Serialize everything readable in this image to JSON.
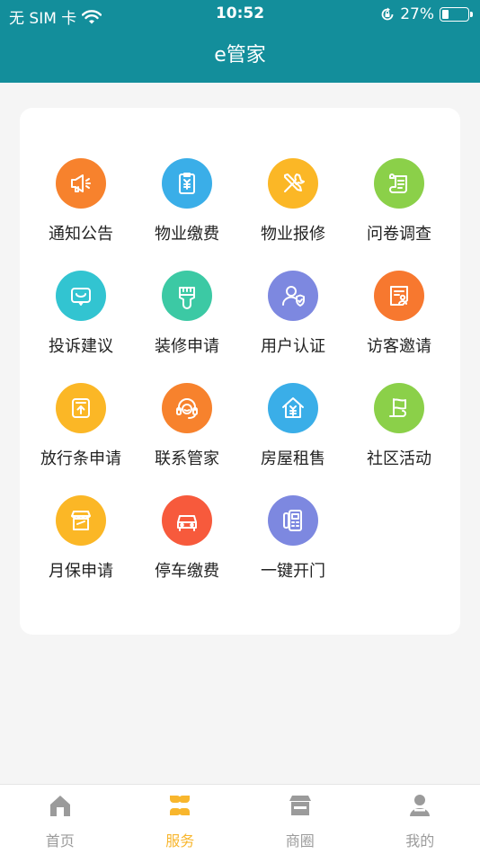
{
  "status_bar": {
    "carrier": "无 SIM 卡",
    "time": "10:52",
    "battery_text": "27%",
    "battery_level": 0.27
  },
  "header": {
    "title": "e管家"
  },
  "services": [
    {
      "label": "通知公告",
      "icon": "megaphone-icon",
      "color": "#f7822d"
    },
    {
      "label": "物业缴费",
      "icon": "bill-icon",
      "color": "#3aaee8"
    },
    {
      "label": "物业报修",
      "icon": "tools-icon",
      "color": "#fbb726"
    },
    {
      "label": "问卷调查",
      "icon": "scroll-icon",
      "color": "#8bd049"
    },
    {
      "label": "投诉建议",
      "icon": "message-box-icon",
      "color": "#32c4d1"
    },
    {
      "label": "装修申请",
      "icon": "paint-brush-icon",
      "color": "#3cc9a4"
    },
    {
      "label": "用户认证",
      "icon": "user-verified-icon",
      "color": "#7d88e0"
    },
    {
      "label": "访客邀请",
      "icon": "visitor-card-icon",
      "color": "#f7782f"
    },
    {
      "label": "放行条申请",
      "icon": "upload-pass-icon",
      "color": "#fbb726"
    },
    {
      "label": "联系管家",
      "icon": "headset-icon",
      "color": "#f7822d"
    },
    {
      "label": "房屋租售",
      "icon": "house-yen-icon",
      "color": "#3aaee8"
    },
    {
      "label": "社区活动",
      "icon": "flag-icon",
      "color": "#8bd049"
    },
    {
      "label": "月保申请",
      "icon": "store-icon",
      "color": "#fbb726"
    },
    {
      "label": "停车缴费",
      "icon": "car-icon",
      "color": "#f75a3c"
    },
    {
      "label": "一键开门",
      "icon": "door-phone-icon",
      "color": "#7d88e0"
    }
  ],
  "tabbar": {
    "active_color": "#f8b62d",
    "inactive_color": "#9b9b9b",
    "tabs": [
      {
        "label": "首页",
        "icon": "home-icon",
        "active": false
      },
      {
        "label": "服务",
        "icon": "grid-petal-icon",
        "active": true
      },
      {
        "label": "商圈",
        "icon": "shop-icon",
        "active": false
      },
      {
        "label": "我的",
        "icon": "person-icon",
        "active": false
      }
    ]
  }
}
